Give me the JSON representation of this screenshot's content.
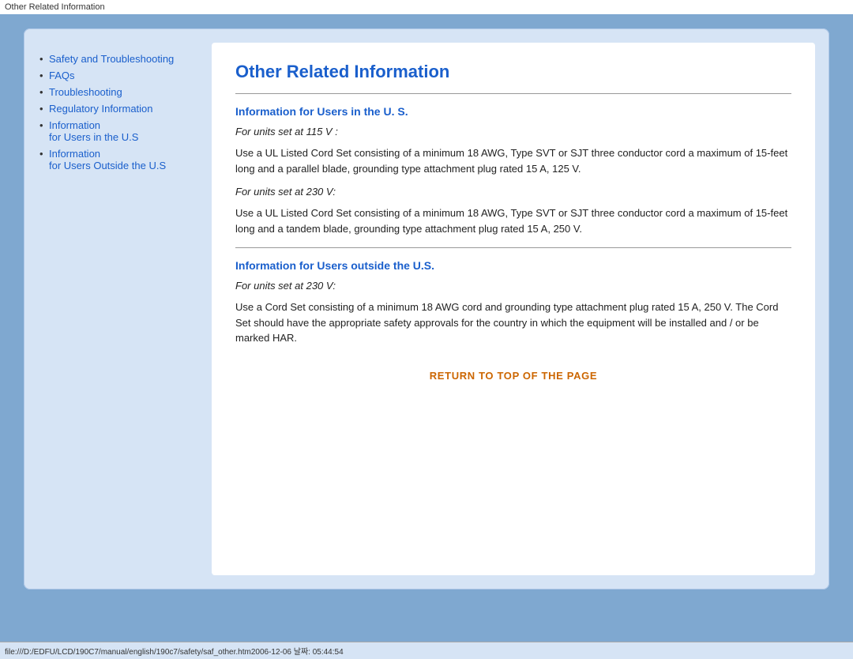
{
  "titleBar": {
    "text": "Other Related Information"
  },
  "sidebar": {
    "items": [
      {
        "label": "Safety and Troubleshooting",
        "href": "#",
        "sub": false
      },
      {
        "label": "FAQs",
        "href": "#",
        "sub": false
      },
      {
        "label": "Troubleshooting",
        "href": "#",
        "sub": false
      },
      {
        "label": "Regulatory Information",
        "href": "#",
        "sub": false
      },
      {
        "label": "Information\nfor Users in the U.S",
        "href": "#",
        "sub": false
      },
      {
        "label": "Information\nfor Users Outside the U.S",
        "href": "#",
        "sub": false
      }
    ]
  },
  "main": {
    "pageTitle": "Other Related Information",
    "section1": {
      "heading": "Information for Users in the U. S.",
      "intro": "For units set at 115 V :",
      "body1": "Use a UL Listed Cord Set consisting of a minimum 18 AWG, Type SVT or SJT three conductor cord a maximum of 15-feet long and a parallel blade, grounding type attachment plug rated 15 A, 125 V.",
      "intro2": "For units set at 230 V:",
      "body2": "Use a UL Listed Cord Set consisting of a minimum 18 AWG, Type SVT or SJT three conductor cord a maximum of 15-feet long and a tandem blade, grounding type attachment plug rated 15 A, 250 V."
    },
    "section2": {
      "heading": "Information for Users outside the U.S.",
      "intro": "For units set at 230 V:",
      "body": "Use a Cord Set consisting of a minimum 18 AWG cord and grounding type attachment plug rated 15 A, 250 V. The Cord Set should have the appropriate safety approvals for the country in which the equipment will be installed and / or be marked HAR."
    },
    "returnLink": "RETURN TO TOP OF THE PAGE"
  },
  "statusBar": {
    "text": "file:///D:/EDFU/LCD/190C7/manual/english/190c7/safety/saf_other.htm2006-12-06 날짜: 05:44:54"
  }
}
